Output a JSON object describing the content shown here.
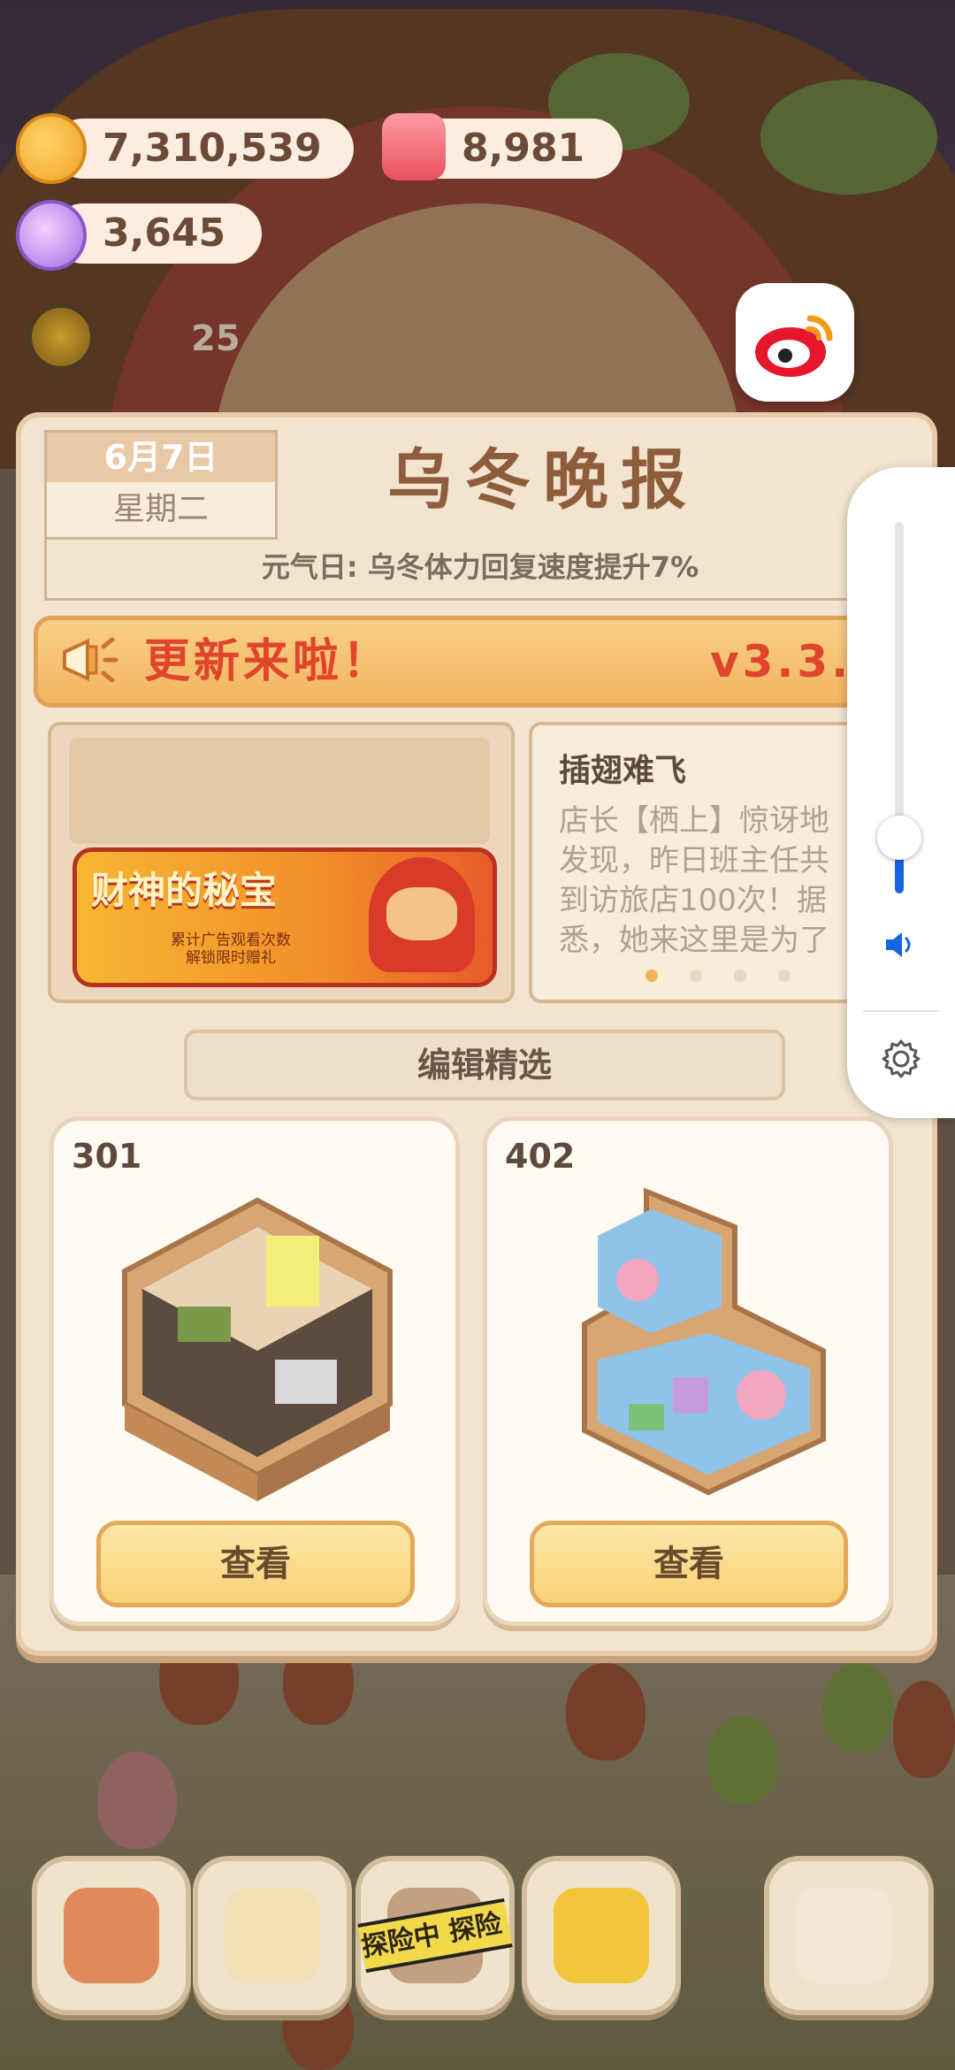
{
  "currencies": {
    "coins": "7,310,539",
    "gems": "8,981",
    "crystals": "3,645",
    "visitors": "25"
  },
  "newspaper": {
    "date": "6月7日",
    "weekday": "星期二",
    "title": "乌冬晚报",
    "subline": "元气日: 乌冬体力回复速度提升7%",
    "update_banner": "更新来啦！",
    "version": "v3.3.0",
    "promo": {
      "title": "财神的秘宝",
      "sub_line1": "累计广告观看次数",
      "sub_line2": "解锁限时赠礼"
    },
    "story": {
      "title": "插翅难飞",
      "lines": [
        "店长【栖上】惊讶地",
        "发现，昨日班主任共",
        "到访旅店100次！据",
        "悉，她来这里是为了"
      ]
    },
    "editor_pick_label": "编辑精选",
    "rooms": [
      {
        "number": "301",
        "button": "查看"
      },
      {
        "number": "402",
        "button": "查看"
      }
    ]
  },
  "bottom_nav": {
    "tape_text": "探险中 探险"
  },
  "icons": {
    "coins": "gold-coin-icon",
    "gems": "red-gem-icon",
    "crystals": "purple-crystal-icon",
    "share": "weibo-icon",
    "volume": "speaker-icon",
    "settings": "gear-icon"
  },
  "colors": {
    "accent_red": "#e0452b",
    "panel_bg": "#f3e4cf",
    "volume_blue": "#1565e0"
  },
  "volume_level": 0.1
}
